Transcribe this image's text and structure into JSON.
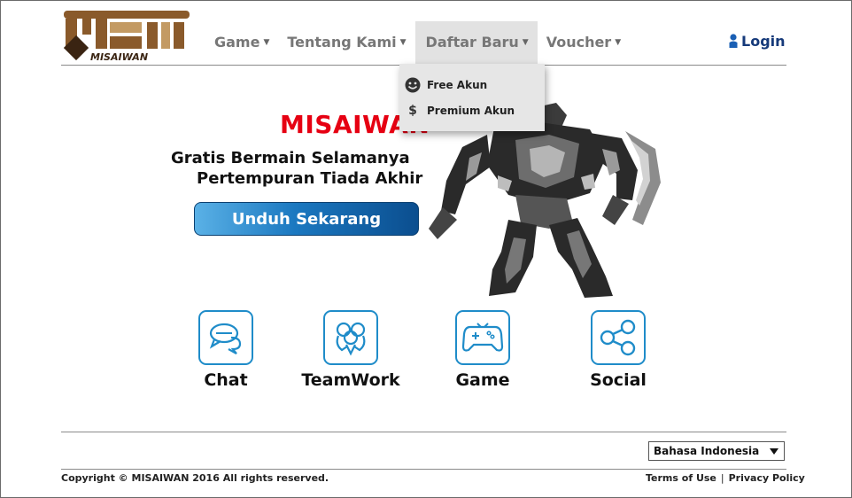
{
  "logo": {
    "text": "MISAIWAN",
    "colors": {
      "brown": "#8a5a2b",
      "dark": "#3a2412",
      "light": "#c39a63"
    }
  },
  "nav": {
    "items": [
      {
        "label": "Game",
        "caret": "▼"
      },
      {
        "label": "Tentang Kami",
        "caret": "▼"
      },
      {
        "label": "Daftar Baru",
        "caret": "▼",
        "active": true
      },
      {
        "label": "Voucher",
        "caret": "▼"
      }
    ],
    "login_label": "Login",
    "login_icon": "user-icon"
  },
  "dropdown": {
    "items": [
      {
        "label": "Free Akun",
        "icon": "smiley-icon"
      },
      {
        "label": "Premium Akun",
        "icon": "dollar-icon",
        "glyph": "$"
      }
    ]
  },
  "hero": {
    "brand": "MISAIWAN",
    "tagline_line1": "Gratis Bermain Selamanya",
    "tagline_line2": "Pertempuran Tiada Akhir",
    "download_label": "Unduh Sekarang",
    "image": "robot-illustration"
  },
  "features": [
    {
      "label": "Chat",
      "icon": "chat-icon"
    },
    {
      "label": "TeamWork",
      "icon": "teamwork-icon"
    },
    {
      "label": "Game",
      "icon": "gamepad-icon"
    },
    {
      "label": "Social",
      "icon": "share-icon"
    }
  ],
  "footer": {
    "language": "Bahasa Indonesia",
    "copyright": "Copyright © MISAIWAN 2016 All rights reserved.",
    "terms": "Terms of Use",
    "separator": "|",
    "privacy": "Privacy Policy"
  },
  "colors": {
    "accent": "#1f8cc9",
    "brand_red": "#e60012",
    "login_blue": "#163a7a",
    "nav_gray": "#777777"
  }
}
